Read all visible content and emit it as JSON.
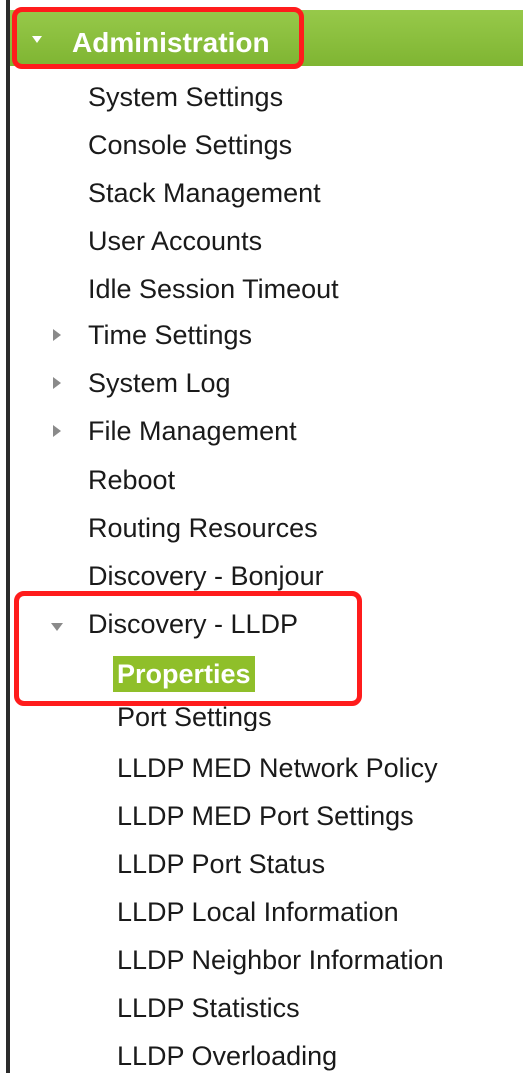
{
  "nav": {
    "header": "Administration",
    "items": [
      {
        "label": "System Settings"
      },
      {
        "label": "Console Settings"
      },
      {
        "label": "Stack Management"
      },
      {
        "label": "User Accounts"
      },
      {
        "label": "Idle Session Timeout"
      },
      {
        "label": "Time Settings",
        "expandable": true
      },
      {
        "label": "System Log",
        "expandable": true
      },
      {
        "label": "File Management",
        "expandable": true
      },
      {
        "label": "Reboot"
      },
      {
        "label": "Routing Resources"
      },
      {
        "label": "Discovery - Bonjour"
      },
      {
        "label": "Discovery - LLDP",
        "expanded": true
      }
    ],
    "lldp_subitems": [
      {
        "label": "Properties",
        "selected": true
      },
      {
        "label": "Port Settings"
      },
      {
        "label": "LLDP MED Network Policy"
      },
      {
        "label": "LLDP MED Port Settings"
      },
      {
        "label": "LLDP Port Status"
      },
      {
        "label": "LLDP Local Information"
      },
      {
        "label": "LLDP Neighbor Information"
      },
      {
        "label": "LLDP Statistics"
      },
      {
        "label": "LLDP Overloading"
      }
    ]
  },
  "colors": {
    "header_green": "#8bbf3c",
    "selected_green": "#8fbf2a",
    "highlight_red": "#ff1c1c"
  }
}
